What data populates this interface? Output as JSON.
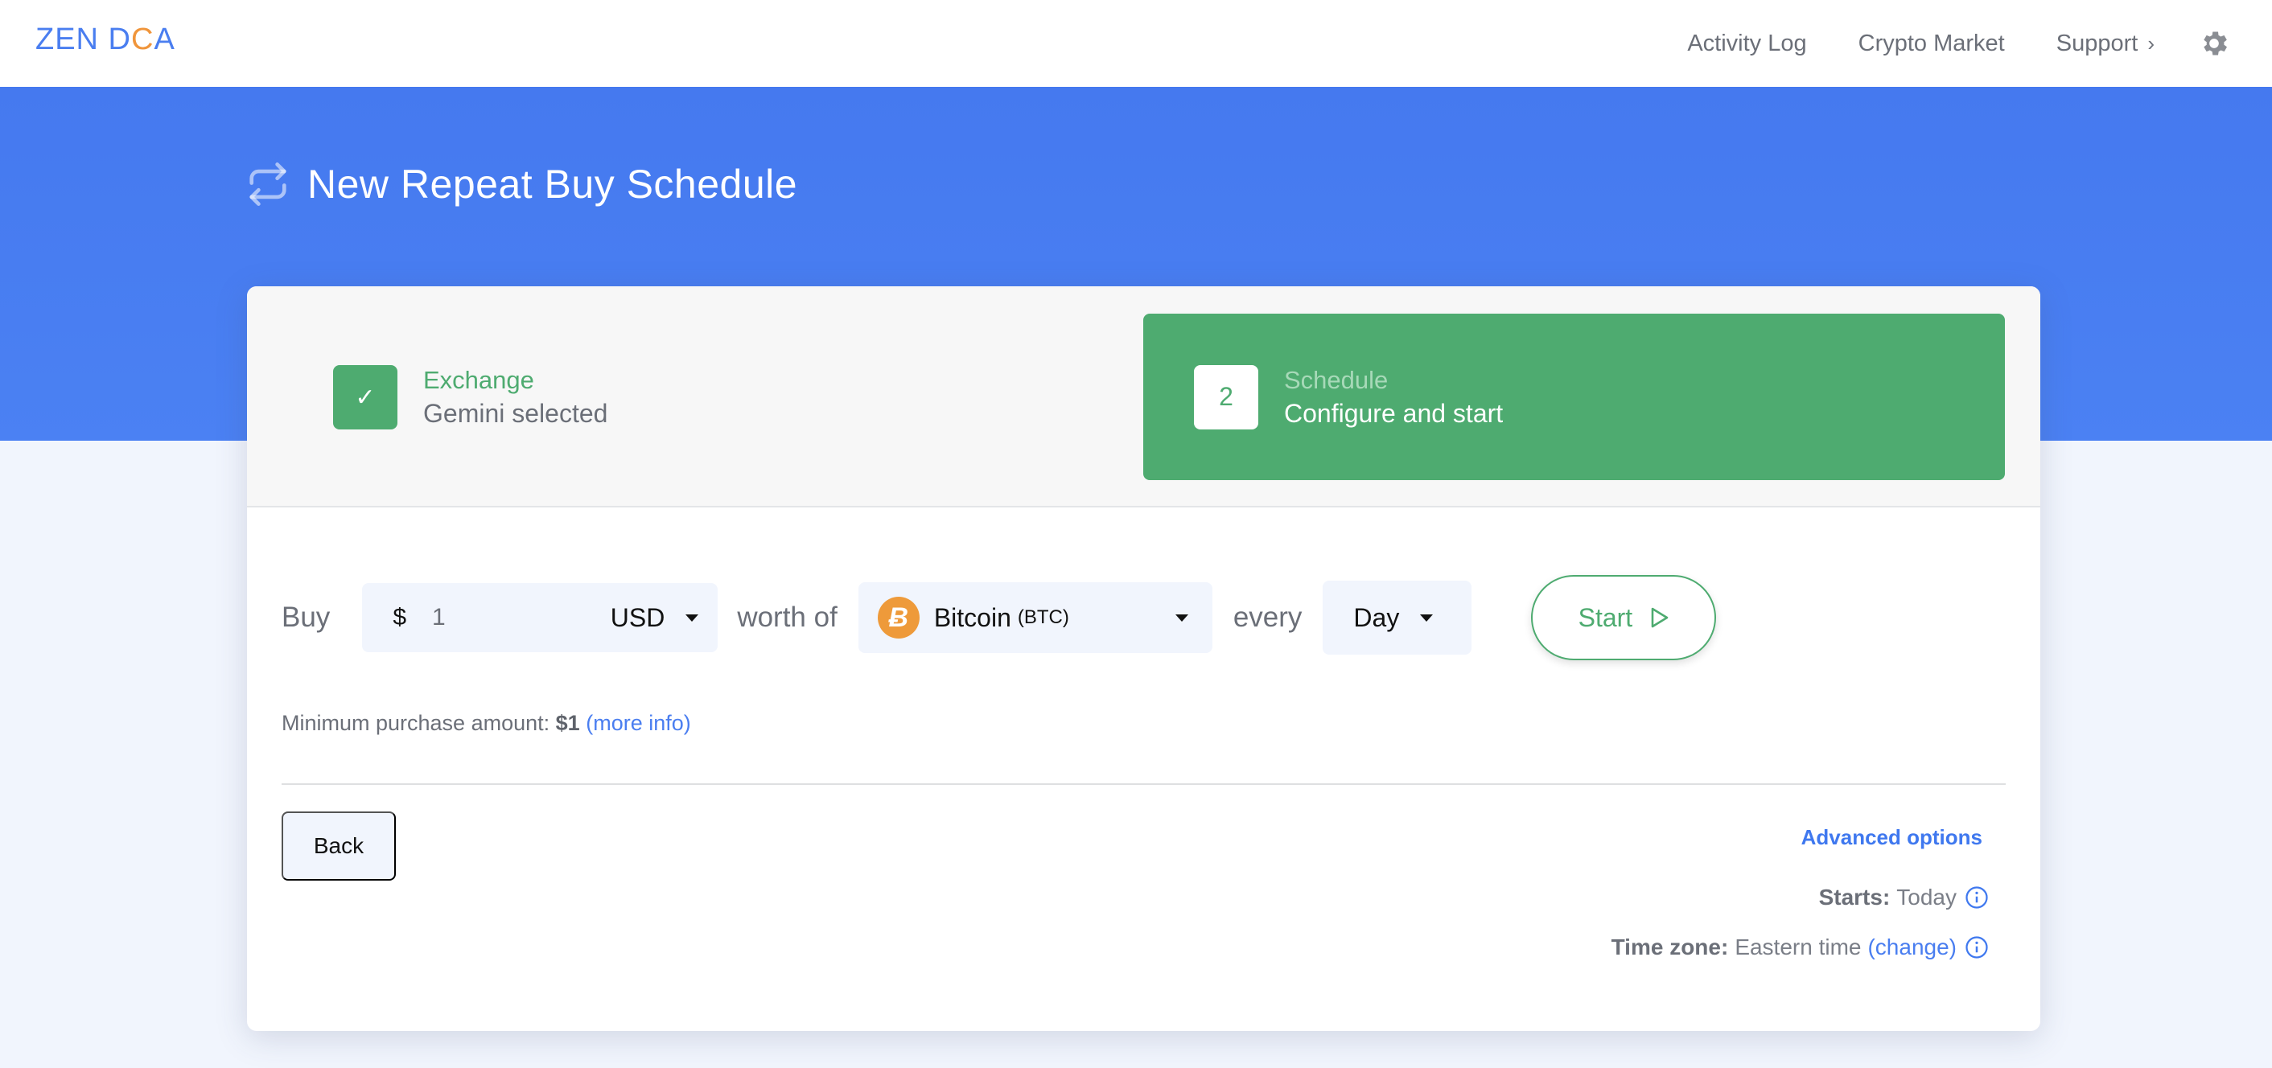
{
  "brand": {
    "logo_part1": "ZEN D",
    "logo_accent": "C",
    "logo_part2": "A"
  },
  "nav": {
    "links": [
      {
        "label": "Activity Log"
      },
      {
        "label": "Crypto Market"
      },
      {
        "label": "Support",
        "icon": "chevron-right-icon",
        "glyph": "›"
      }
    ],
    "settings_icon": "gear-icon"
  },
  "page": {
    "title": "New Repeat Buy Schedule",
    "title_icon": "repeat-icon"
  },
  "steps": [
    {
      "badge": "✓",
      "title": "Exchange",
      "subtitle": "Gemini selected",
      "state": "done"
    },
    {
      "badge": "2",
      "title": "Schedule",
      "subtitle": "Configure and start",
      "state": "active"
    }
  ],
  "form": {
    "buy_label": "Buy",
    "currency_symbol": "$",
    "amount_value": "1",
    "currency": "USD",
    "worth_of_label": "worth of",
    "coin": {
      "name": "Bitcoin",
      "symbol": "(BTC)",
      "icon_glyph": "Ƀ"
    },
    "every_label": "every",
    "frequency": "Day",
    "start_label": "Start"
  },
  "minimum": {
    "label": "Minimum purchase amount:",
    "amount": "$1",
    "link": "(more info)"
  },
  "footer": {
    "back_label": "Back",
    "advanced_label": "Advanced options",
    "starts_label": "Starts:",
    "starts_value": "Today",
    "timezone_label": "Time zone:",
    "timezone_value": "Eastern time",
    "timezone_change": "(change)"
  },
  "colors": {
    "brand_blue": "#4a7ef0",
    "accent_orange": "#f0953b",
    "success_green": "#4eab70",
    "hero_blue": "#4579ef"
  }
}
